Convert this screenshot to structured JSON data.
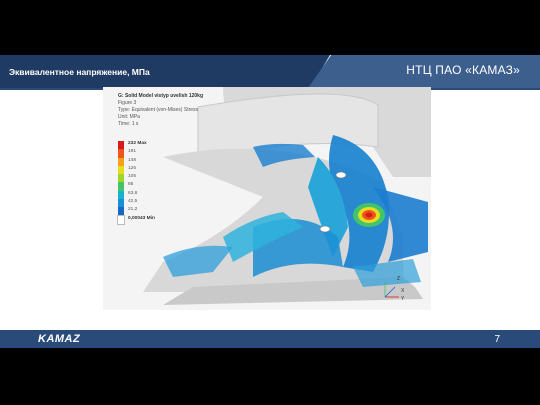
{
  "header": {
    "title": "Эквивалентное напряжение, МПа",
    "brand": "НТЦ ПАО «КАМАЗ»"
  },
  "simulation": {
    "model_title": "G: Solid Model vistyp uvelish 120kg",
    "figure": "Figure 3",
    "type": "Type: Equivalent (von-Mises) Stress",
    "unit": "Unit: MPa",
    "time": "Time: 1 s",
    "legend": [
      {
        "label": "232 Max",
        "color": "#d71a1a"
      },
      {
        "label": "191",
        "color": "#f0541b"
      },
      {
        "label": "148",
        "color": "#f5a11a"
      },
      {
        "label": "126",
        "color": "#e6dd1e"
      },
      {
        "label": "105",
        "color": "#9fd62a"
      },
      {
        "label": "85",
        "color": "#42c46b"
      },
      {
        "label": "63,6",
        "color": "#18b2c9"
      },
      {
        "label": "42,5",
        "color": "#1a8fd6"
      },
      {
        "label": "21,2",
        "color": "#1568c4"
      },
      {
        "label": "0,00043 Min",
        "color": "#ffffff"
      }
    ],
    "axes": [
      "Z",
      "Y",
      "X"
    ]
  },
  "footer": {
    "logo": "KAMAZ",
    "page_number": "7"
  },
  "colors": {
    "header_dark": "#1f3a63",
    "header_light": "#3d5f8e",
    "footer_bar": "#2a4b7a"
  }
}
